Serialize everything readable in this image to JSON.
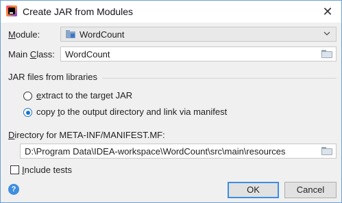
{
  "window": {
    "title": "Create JAR from Modules",
    "close_glyph": "✕",
    "app_icon": "intellij-idea-icon"
  },
  "module": {
    "label": "Module:",
    "label_mnemonic": "M",
    "label_rest": "odule:",
    "value": "WordCount",
    "arrow": "⌄"
  },
  "main_class": {
    "label_prefix": "Main ",
    "label_mnemonic": "C",
    "label_rest": "lass:",
    "value": "WordCount"
  },
  "libraries": {
    "section_title": "JAR files from libraries",
    "options": [
      {
        "prefix": "",
        "mnemonic": "e",
        "rest": "xtract to the target JAR",
        "checked": false
      },
      {
        "prefix": "copy ",
        "mnemonic": "t",
        "rest": "o the output directory and link via manifest",
        "checked": true
      }
    ]
  },
  "manifest_dir": {
    "label_mnemonic": "D",
    "label_rest": "irectory for META-INF/MANIFEST.MF:",
    "value": "D:\\Program Data\\IDEA-workspace\\WordCount\\src\\main\\resources"
  },
  "include_tests": {
    "label_mnemonic": "I",
    "label_rest": "nclude tests",
    "checked": false
  },
  "buttons": {
    "help": "?",
    "ok": "OK",
    "cancel": "Cancel"
  },
  "colors": {
    "accent": "#1a73c8",
    "window_border": "#6aa0d6",
    "background": "#f0f0f0"
  }
}
